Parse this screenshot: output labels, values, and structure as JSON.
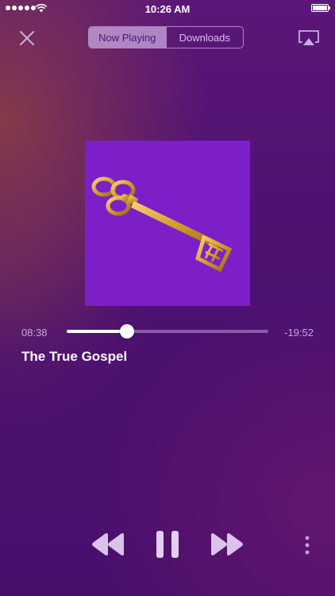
{
  "status_bar": {
    "time": "10:26 AM",
    "signal_bars": 5,
    "battery_level": 1.0,
    "icons": [
      "signal-dots",
      "wifi-icon",
      "battery-icon"
    ]
  },
  "header": {
    "close_icon": "close-icon",
    "tabs": [
      {
        "label": "Now Playing",
        "active": true
      },
      {
        "label": "Downloads",
        "active": false
      }
    ],
    "airplay_icon": "airplay-icon"
  },
  "artwork": {
    "icon": "golden-key-artwork",
    "background_color": "#7d1fc8",
    "key_color": "#d9a830"
  },
  "player": {
    "elapsed": "08:38",
    "remaining": "-19:52",
    "progress": 0.3,
    "title": "The True Gospel"
  },
  "controls": {
    "icons": [
      "rewind-icon",
      "pause-icon",
      "fast-forward-icon",
      "more-icon"
    ]
  },
  "colors": {
    "background": "#4d1170",
    "accent": "#ffffff",
    "segment_fill": "#c8aae1"
  }
}
